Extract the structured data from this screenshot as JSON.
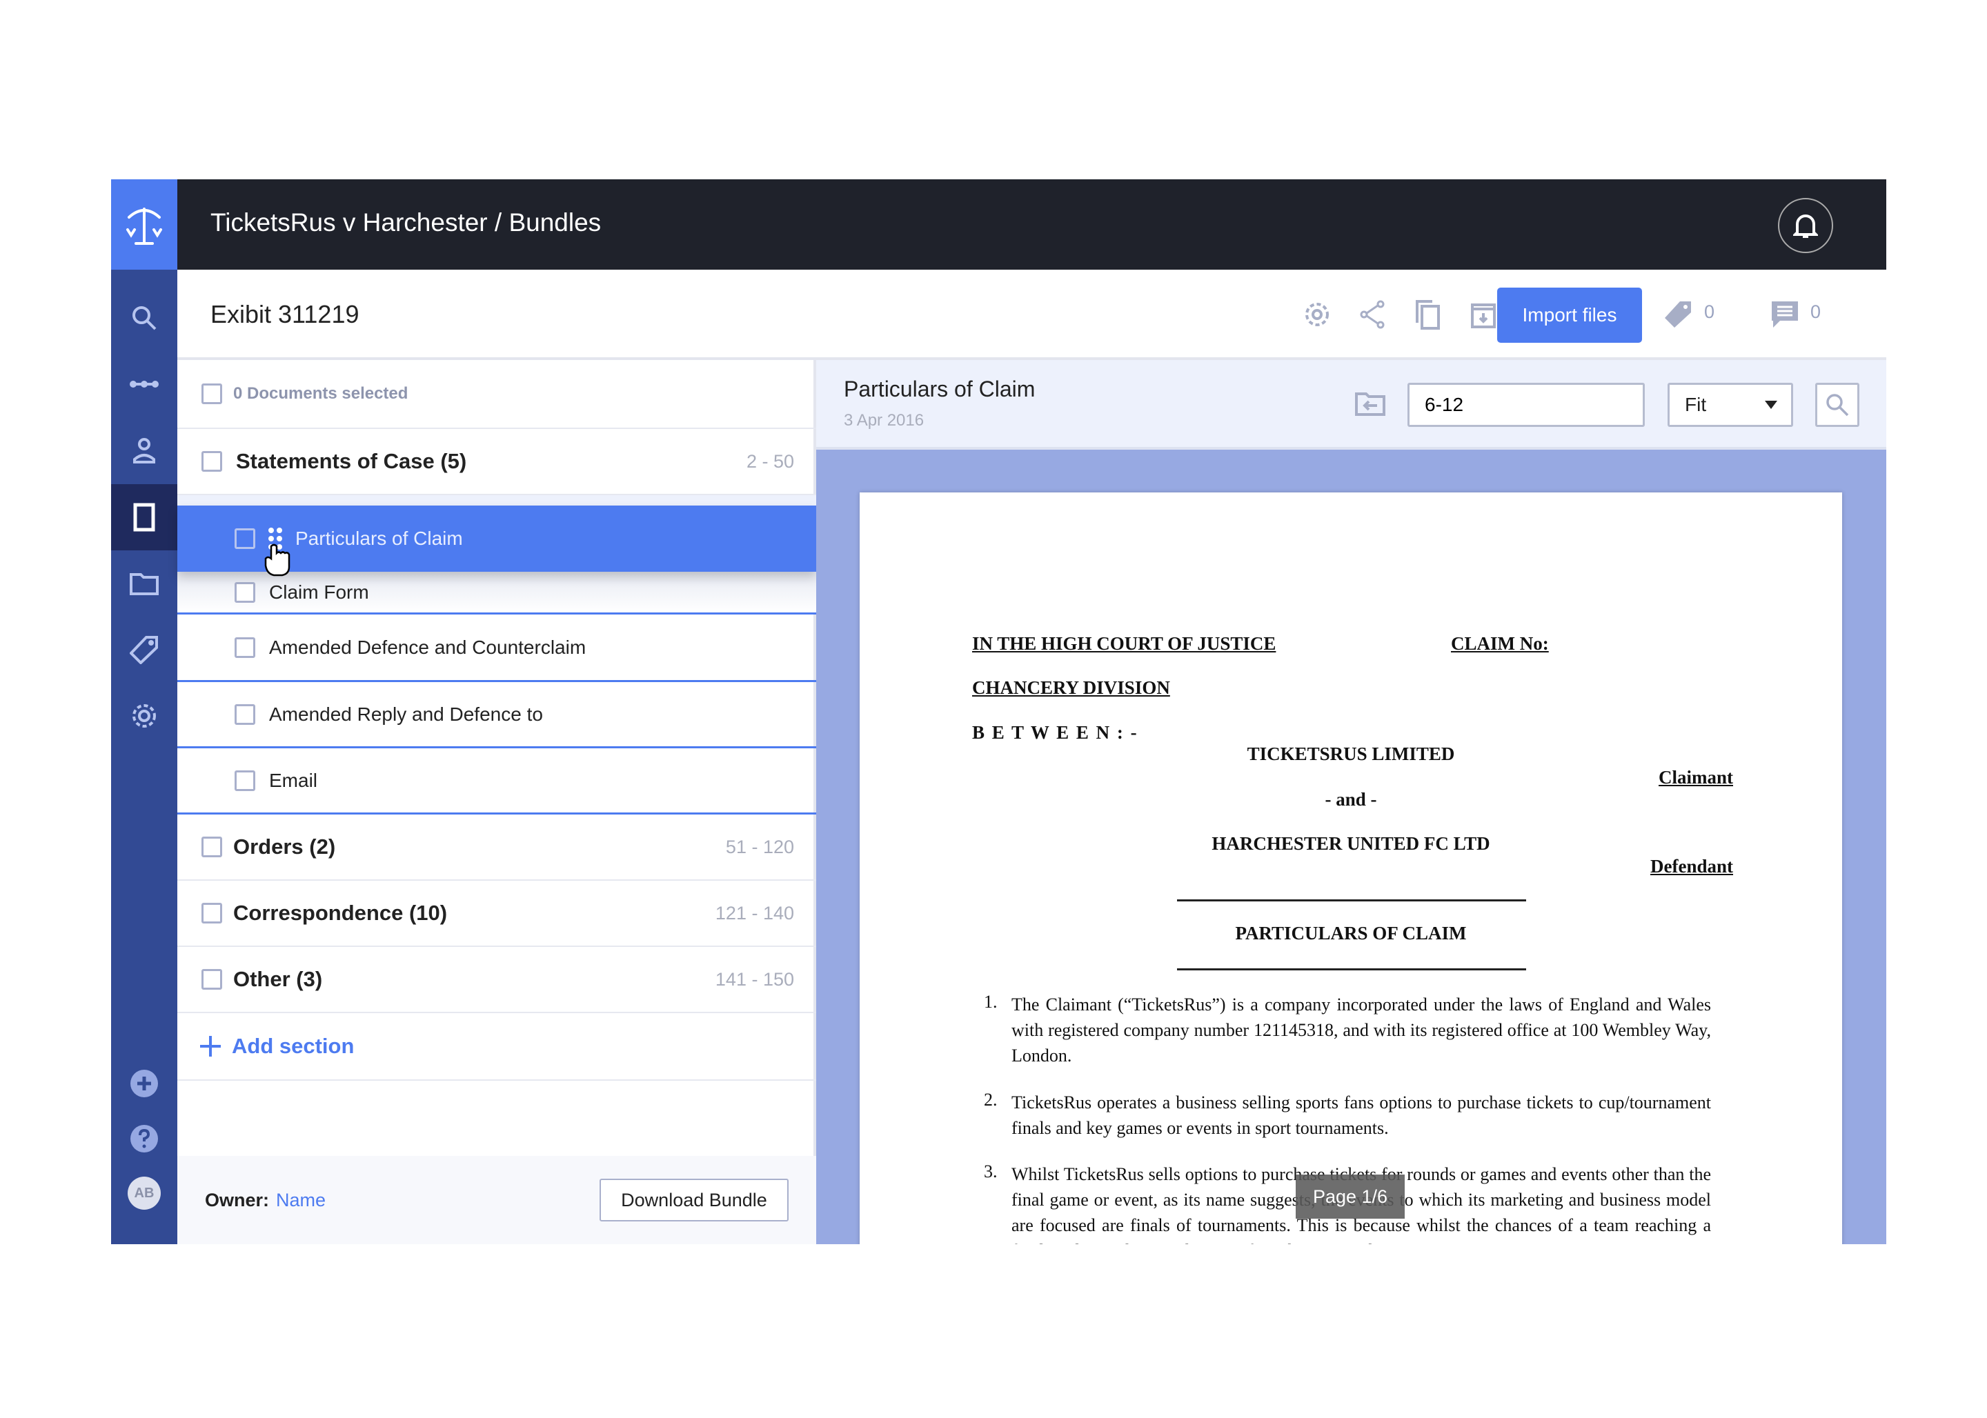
{
  "topbar": {
    "breadcrumb": "TicketsRus v Harchester / Bundles"
  },
  "header": {
    "title": "Exibit 311219",
    "import_label": "Import files",
    "tags_count": "0",
    "comments_count": "0"
  },
  "sidebar": {
    "items": [
      "search",
      "timeline",
      "contacts",
      "bundles",
      "folders",
      "tags",
      "settings"
    ],
    "active": "bundles",
    "avatar_initials": "AB"
  },
  "left": {
    "selected_label": "0 Documents selected",
    "sections": [
      {
        "title": "Statements of Case (5)",
        "range": "2 - 50",
        "documents": [
          "Particulars of Claim",
          "Claim Form",
          "Amended Defence and Counterclaim",
          "Amended Reply and Defence to",
          "Email"
        ]
      },
      {
        "title": "Orders (2)",
        "range": "51 - 120"
      },
      {
        "title": "Correspondence (10)",
        "range": "121 - 140"
      },
      {
        "title": "Other (3)",
        "range": "141 - 150"
      }
    ],
    "add_section": "Add section",
    "owner_label": "Owner:",
    "owner_name": "Name",
    "download_label": "Download Bundle"
  },
  "viewer": {
    "title": "Particulars of Claim",
    "date": "3 Apr 2016",
    "page_range": "6-12",
    "zoom": "Fit",
    "page_indicator": "Page 1/6",
    "doc": {
      "court": "IN THE HIGH COURT OF JUSTICE",
      "claim_no": "CLAIM No:",
      "division": "CHANCERY DIVISION",
      "between": "B E T W E E N : -",
      "claimant_name": "TICKETSRUS LIMITED",
      "claimant": "Claimant",
      "and": "- and -",
      "defendant_name": "HARCHESTER UNITED FC LTD",
      "defendant": "Defendant",
      "heading": "PARTICULARS OF CLAIM",
      "paragraphs": [
        {
          "n": "1.",
          "text": "The Claimant (“TicketsRus”) is a company incorporated under the laws of England and Wales with registered company number 121145318, and with its registered office at 100 Wembley Way, London."
        },
        {
          "n": "2.",
          "text": "TicketsRus operates a business selling sports fans options to purchase tickets to cup/tournament finals and key games or events in sport tournaments."
        },
        {
          "n": "3.",
          "text": "Whilst TicketsRus sells options to purchase tickets for rounds or games and events other than the final game or event, as its name suggests, the events to which its marketing and business model are focused are finals of tournaments. This is because whilst the chances of a team reaching a final are lower than its chances of reaching any other"
        }
      ]
    }
  },
  "colors": {
    "accent": "#4d7bf0",
    "sidebar": "#324a94",
    "topbar": "#1f222b",
    "viewer_bg": "#97a9e2"
  }
}
